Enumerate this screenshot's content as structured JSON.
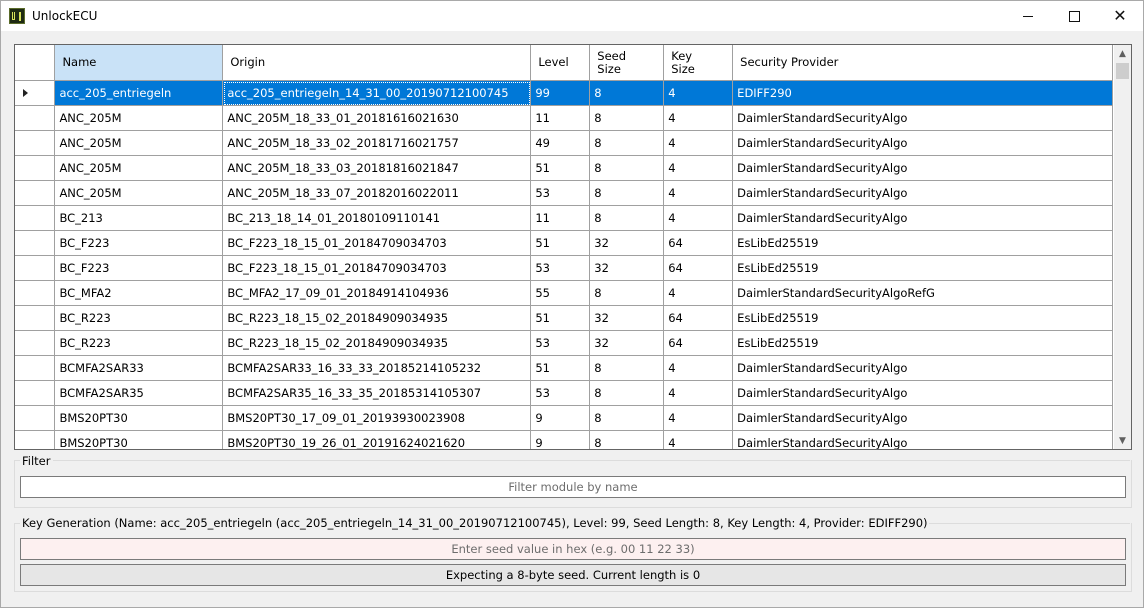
{
  "window": {
    "title": "UnlockECU",
    "controls": {
      "minimize": "minimize-icon",
      "maximize": "maximize-icon",
      "close": "close-icon"
    }
  },
  "table": {
    "columns": [
      {
        "key": "name",
        "label": "Name"
      },
      {
        "key": "origin",
        "label": "Origin"
      },
      {
        "key": "level",
        "label": "Level"
      },
      {
        "key": "seed_size",
        "label": "Seed\nSize"
      },
      {
        "key": "key_size",
        "label": "Key\nSize"
      },
      {
        "key": "provider",
        "label": "Security Provider"
      }
    ],
    "sorted_column": "name",
    "selected_row": 0,
    "rows": [
      [
        "acc_205_entriegeln",
        "acc_205_entriegeln_14_31_00_20190712100745",
        "99",
        "8",
        "4",
        "EDIFF290"
      ],
      [
        "ANC_205M",
        "ANC_205M_18_33_01_20181616021630",
        "11",
        "8",
        "4",
        "DaimlerStandardSecurityAlgo"
      ],
      [
        "ANC_205M",
        "ANC_205M_18_33_02_20181716021757",
        "49",
        "8",
        "4",
        "DaimlerStandardSecurityAlgo"
      ],
      [
        "ANC_205M",
        "ANC_205M_18_33_03_20181816021847",
        "51",
        "8",
        "4",
        "DaimlerStandardSecurityAlgo"
      ],
      [
        "ANC_205M",
        "ANC_205M_18_33_07_20182016022011",
        "53",
        "8",
        "4",
        "DaimlerStandardSecurityAlgo"
      ],
      [
        "BC_213",
        "BC_213_18_14_01_20180109110141",
        "11",
        "8",
        "4",
        "DaimlerStandardSecurityAlgo"
      ],
      [
        "BC_F223",
        "BC_F223_18_15_01_20184709034703",
        "51",
        "32",
        "64",
        "EsLibEd25519"
      ],
      [
        "BC_F223",
        "BC_F223_18_15_01_20184709034703",
        "53",
        "32",
        "64",
        "EsLibEd25519"
      ],
      [
        "BC_MFA2",
        "BC_MFA2_17_09_01_20184914104936",
        "55",
        "8",
        "4",
        "DaimlerStandardSecurityAlgoRefG"
      ],
      [
        "BC_R223",
        "BC_R223_18_15_02_20184909034935",
        "51",
        "32",
        "64",
        "EsLibEd25519"
      ],
      [
        "BC_R223",
        "BC_R223_18_15_02_20184909034935",
        "53",
        "32",
        "64",
        "EsLibEd25519"
      ],
      [
        "BCMFA2SAR33",
        "BCMFA2SAR33_16_33_33_20185214105232",
        "51",
        "8",
        "4",
        "DaimlerStandardSecurityAlgo"
      ],
      [
        "BCMFA2SAR35",
        "BCMFA2SAR35_16_33_35_20185314105307",
        "53",
        "8",
        "4",
        "DaimlerStandardSecurityAlgo"
      ],
      [
        "BMS20PT30",
        "BMS20PT30_17_09_01_20193930023908",
        "9",
        "8",
        "4",
        "DaimlerStandardSecurityAlgo"
      ],
      [
        "BMS20PT30",
        "BMS20PT30_19_26_01_20191624021620",
        "9",
        "8",
        "4",
        "DaimlerStandardSecurityAlgo"
      ]
    ]
  },
  "filter": {
    "group_label": "Filter",
    "placeholder": "Filter module by name",
    "value": ""
  },
  "key_generation": {
    "group_label": "Key Generation (Name: acc_205_entriegeln (acc_205_entriegeln_14_31_00_20190712100745), Level: 99, Seed Length: 8, Key Length: 4, Provider: EDIFF290)",
    "seed_placeholder": "Enter seed value in hex (e.g. 00 11 22 33)",
    "seed_value": "",
    "status": "Expecting a 8-byte seed. Current length is 0"
  },
  "colors": {
    "selection": "#0078d7",
    "sorted_header": "#c9e2f7",
    "seed_input_background": "#fdf0f0"
  }
}
